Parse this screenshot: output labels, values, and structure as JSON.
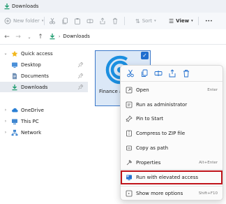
{
  "window": {
    "title": "Downloads"
  },
  "toolbar": {
    "new_folder_label": "New folder",
    "sort_label": "Sort",
    "view_label": "View",
    "more_label": "•••"
  },
  "address": {
    "current": "Downloads"
  },
  "nav": {
    "items": [
      {
        "label": "Quick access",
        "icon": "star-icon"
      },
      {
        "label": "Desktop",
        "icon": "desktop-icon"
      },
      {
        "label": "Documents",
        "icon": "documents-icon"
      },
      {
        "label": "Downloads",
        "icon": "download-icon"
      },
      {
        "label": "OneDrive",
        "icon": "cloud-icon"
      },
      {
        "label": "This PC",
        "icon": "pc-icon"
      },
      {
        "label": "Network",
        "icon": "network-icon"
      }
    ]
  },
  "file": {
    "name": "Finance a"
  },
  "context_menu": {
    "items": [
      {
        "label": "Open",
        "shortcut": "Enter",
        "icon": "open-icon"
      },
      {
        "label": "Run as administrator",
        "shortcut": "",
        "icon": "shield-icon"
      },
      {
        "label": "Pin to Start",
        "shortcut": "",
        "icon": "pin-icon"
      },
      {
        "label": "Compress to ZIP file",
        "shortcut": "",
        "icon": "zip-icon"
      },
      {
        "label": "Copy as path",
        "shortcut": "",
        "icon": "copy-path-icon"
      },
      {
        "label": "Properties",
        "shortcut": "Alt+Enter",
        "icon": "properties-icon"
      },
      {
        "label": "Run with elevated access",
        "shortcut": "",
        "icon": "elevated-icon"
      },
      {
        "label": "Show more options",
        "shortcut": "Shift+F10",
        "icon": "more-options-icon"
      }
    ]
  },
  "colors": {
    "accent": "#1f6ecf",
    "highlight_border": "#c0141b",
    "selection_bg": "#dbe8f7"
  }
}
